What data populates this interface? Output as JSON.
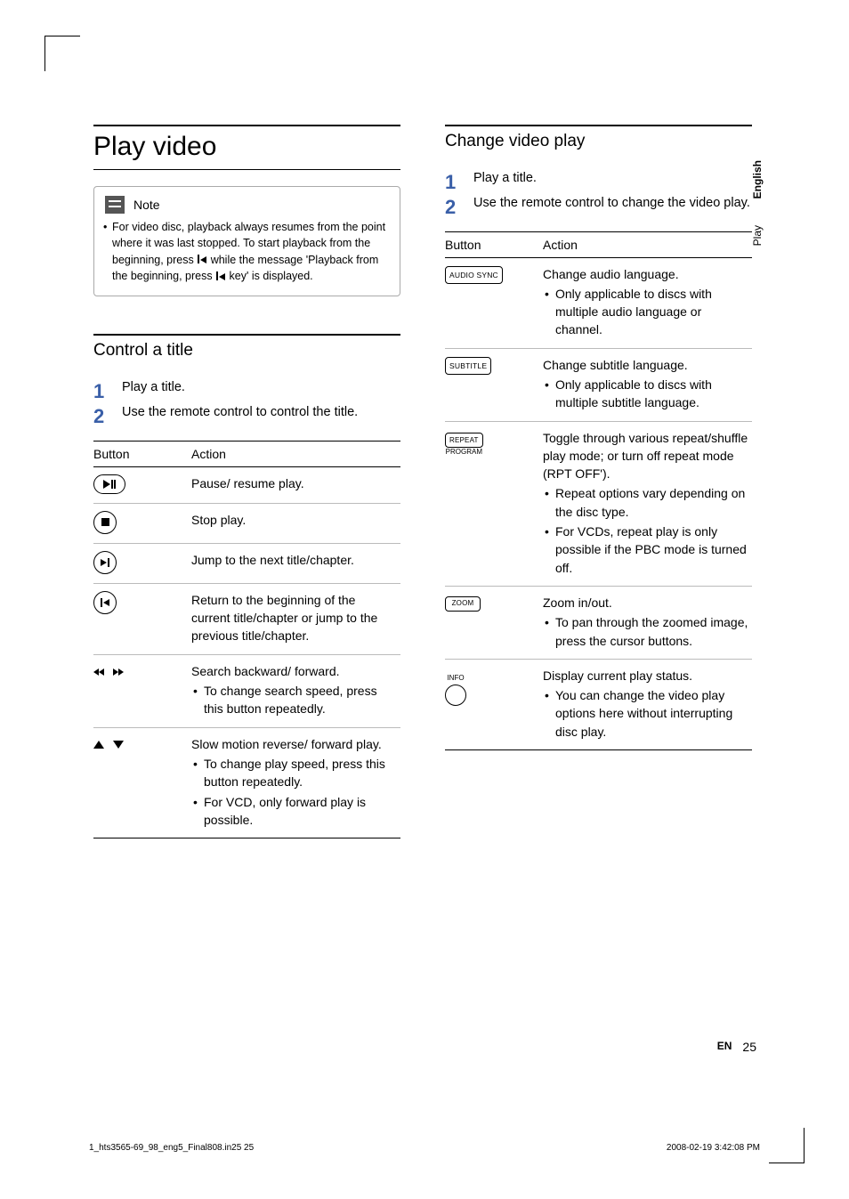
{
  "heading_main": "Play video",
  "note": {
    "label": "Note",
    "text_a": "For video disc, playback always resumes from the point where it was last stopped. To start playback from the beginning, press ",
    "text_b": " while the message 'Playback from the beginning, press ",
    "text_c": " key' is displayed."
  },
  "section_control": {
    "title": "Control a title",
    "step1": "Play a title.",
    "step2": "Use the remote control to control the title."
  },
  "table_headers": {
    "button": "Button",
    "action": "Action"
  },
  "control_rows": [
    {
      "icon": "play-pause",
      "action": "Pause/ resume play."
    },
    {
      "icon": "stop",
      "action": "Stop play."
    },
    {
      "icon": "next",
      "action": "Jump to the next title/chapter."
    },
    {
      "icon": "prev",
      "action": "Return to the beginning of the current title/chapter or jump to the previous title/chapter."
    },
    {
      "icon": "search",
      "action": "Search backward/ forward.",
      "sub": [
        "To change search speed, press this button repeatedly."
      ]
    },
    {
      "icon": "updown",
      "action": "Slow motion reverse/ forward play.",
      "sub": [
        "To change play speed, press this button repeatedly.",
        "For VCD, only forward play is possible."
      ]
    }
  ],
  "section_change": {
    "title": "Change video play",
    "step1": "Play a title.",
    "step2": "Use the remote control to change the video play."
  },
  "change_rows": [
    {
      "label": "AUDIO SYNC",
      "action": "Change audio language.",
      "sub": [
        "Only applicable to discs with multiple audio language or channel."
      ]
    },
    {
      "label": "SUBTITLE",
      "action": "Change subtitle language.",
      "sub": [
        "Only applicable to discs with multiple subtitle language."
      ]
    },
    {
      "label": "REPEAT",
      "label2": "PROGRAM",
      "action": "Toggle through various repeat/shuffle play mode; or turn off repeat mode (RPT OFF').",
      "sub": [
        "Repeat options vary depending on the disc type.",
        "For VCDs, repeat play is only possible if the PBC mode is turned off."
      ]
    },
    {
      "label": "ZOOM",
      "action": "Zoom in/out.",
      "sub": [
        "To pan through the zoomed image, press the cursor buttons."
      ]
    },
    {
      "label": "INFO",
      "info": true,
      "action": "Display current play status.",
      "sub": [
        "You can change the video play options here without interrupting disc play."
      ]
    }
  ],
  "side": {
    "lang": "English",
    "section": "Play"
  },
  "footer": {
    "lang": "EN",
    "page": "25"
  },
  "print": {
    "file": "1_hts3565-69_98_eng5_Final808.in25   25",
    "date": "2008-02-19   3:42:08 PM"
  }
}
